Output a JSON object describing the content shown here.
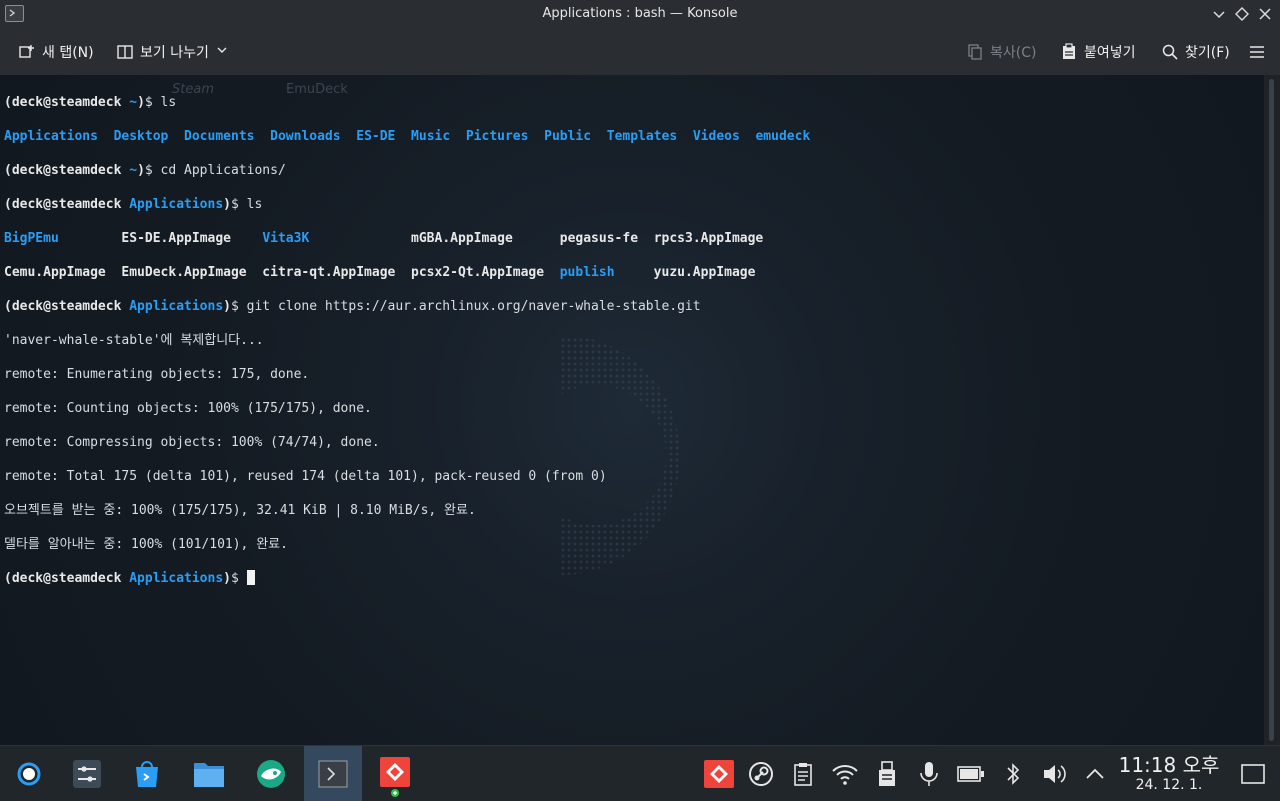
{
  "window": {
    "title": "Applications : bash — Konsole"
  },
  "toolbar": {
    "new_tab": "새 탭(N)",
    "split_view": "보기 나누기",
    "copy": "복사(C)",
    "paste": "붙여넣기",
    "find": "찾기(F)"
  },
  "terminal": {
    "prompt_user": "(deck@steamdeck",
    "ghost_emudeck": "EmuDeck",
    "ghost_steam": "Steam",
    "line1_path": "~",
    "line1_cmd": "$ ls",
    "ls1": [
      "Applications",
      "Desktop",
      "Documents",
      "Downloads",
      "ES-DE",
      "Music",
      "Pictures",
      "Public",
      "Templates",
      "Videos",
      "emudeck"
    ],
    "line3_cmd": "$ cd Applications/",
    "line4_path": "Applications",
    "line4_cmd": "$ ls",
    "ls2_row1": [
      "BigPEmu",
      "ES-DE.AppImage",
      "Vita3K",
      "mGBA.AppImage",
      "pegasus-fe",
      "rpcs3.AppImage"
    ],
    "ls2_row2": [
      "Cemu.AppImage",
      "EmuDeck.AppImage",
      "citra-qt.AppImage",
      "pcsx2-Qt.AppImage",
      "publish",
      "yuzu.AppImage"
    ],
    "line7_cmd": "$ git clone https://aur.archlinux.org/naver-whale-stable.git",
    "out1": "'naver-whale-stable'에 복제합니다...",
    "out2": "remote: Enumerating objects: 175, done.",
    "out3": "remote: Counting objects: 100% (175/175), done.",
    "out4": "remote: Compressing objects: 100% (74/74), done.",
    "out5": "remote: Total 175 (delta 101), reused 174 (delta 101), pack-reused 0 (from 0)",
    "out6": "오브젝트를 받는 중: 100% (175/175), 32.41 KiB | 8.10 MiB/s, 완료.",
    "out7": "델타를 알아내는 중: 100% (101/101), 완료.",
    "last_cmd": "$ "
  },
  "taskbar": {
    "apps": [
      "steam-deck-menu-icon",
      "system-settings-icon",
      "discover-store-icon",
      "dolphin-files-icon",
      "naver-whale-icon",
      "konsole-icon",
      "anydesk-icon"
    ],
    "tray": [
      "anydesk-tray-icon",
      "steam-tray-icon",
      "clipboard-icon",
      "wifi-icon",
      "usb-storage-icon",
      "microphone-icon",
      "battery-icon",
      "bluetooth-icon",
      "volume-icon",
      "tray-expand-icon"
    ],
    "time": "11:18 오후",
    "date": "24. 12. 1."
  },
  "colors": {
    "accent": "#2a9df4",
    "background": "#12181f",
    "panel": "#2a2e33",
    "active_task": "#34495e"
  }
}
